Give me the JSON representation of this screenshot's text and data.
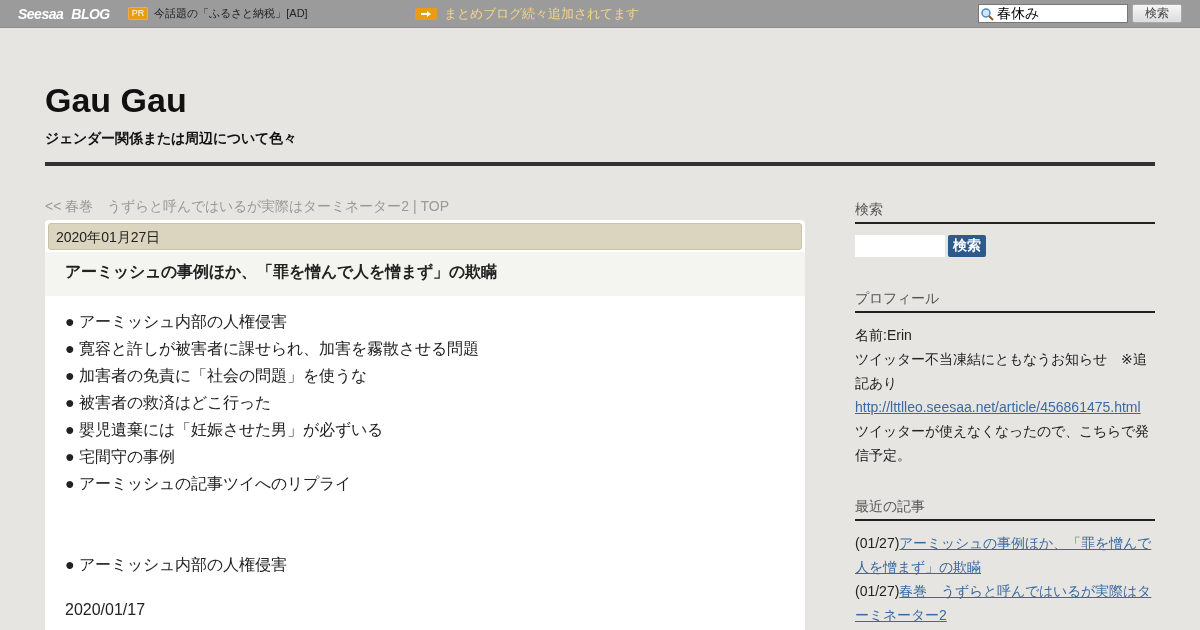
{
  "top_bar": {
    "logo": "Seesaa",
    "logo_suffix": "BLOG",
    "pr_badge": "PR",
    "pr_text": "今話題の「ふるさと納税」[AD]",
    "notice": "まとめブログ続々追加されてます",
    "search": {
      "value": "春休み"
    },
    "search_button": "検索"
  },
  "header": {
    "title": "Gau Gau",
    "subtitle": "ジェンダー関係または周辺について色々"
  },
  "nav": {
    "prev": "<< 春巻　うずらと呼んではいるが実際はターミネーター2",
    "separator": " | ",
    "top": "TOP"
  },
  "post": {
    "date": "2020年01月27日",
    "title": "アーミッシュの事例ほか、「罪を憎んで人を憎まず」の欺瞞",
    "body": [
      {
        "kind": "line",
        "text": "● アーミッシュ内部の人権侵害"
      },
      {
        "kind": "line",
        "text": "● 寛容と許しが被害者に課せられ、加害を霧散させる問題"
      },
      {
        "kind": "line",
        "text": "● 加害者の免責に「社会の問題」を使うな"
      },
      {
        "kind": "line",
        "text": "● 被害者の救済はどこ行った"
      },
      {
        "kind": "line",
        "text": "● 嬰児遺棄には「妊娠させた男」が必ずいる"
      },
      {
        "kind": "line",
        "text": "● 宅間守の事例"
      },
      {
        "kind": "line",
        "text": "● アーミッシュの記事ツイへのリプライ"
      },
      {
        "kind": "gap"
      },
      {
        "kind": "line",
        "text": "● アーミッシュ内部の人権侵害"
      },
      {
        "kind": "gap_small"
      },
      {
        "kind": "line",
        "text": "2020/01/17"
      }
    ]
  },
  "sidebar": {
    "search": {
      "heading": "検索",
      "button": "検索"
    },
    "profile": {
      "heading": "プロフィール",
      "name": "名前:Erin",
      "notice": "ツイッター不当凍結にともなうお知らせ　※追記あり",
      "link": "http://lttlleo.seesaa.net/article/456861475.html",
      "note": "ツイッターが使えなくなったので、こちらで発信予定。"
    },
    "recent": {
      "heading": "最近の記事",
      "items": [
        {
          "date": "(01/27)",
          "title": "アーミッシュの事例ほか、「罪を憎んで人を憎まず」の欺瞞"
        },
        {
          "date": "(01/27)",
          "title": "春巻　うずらと呼んではいるが実際はターミネーター2"
        }
      ]
    }
  }
}
